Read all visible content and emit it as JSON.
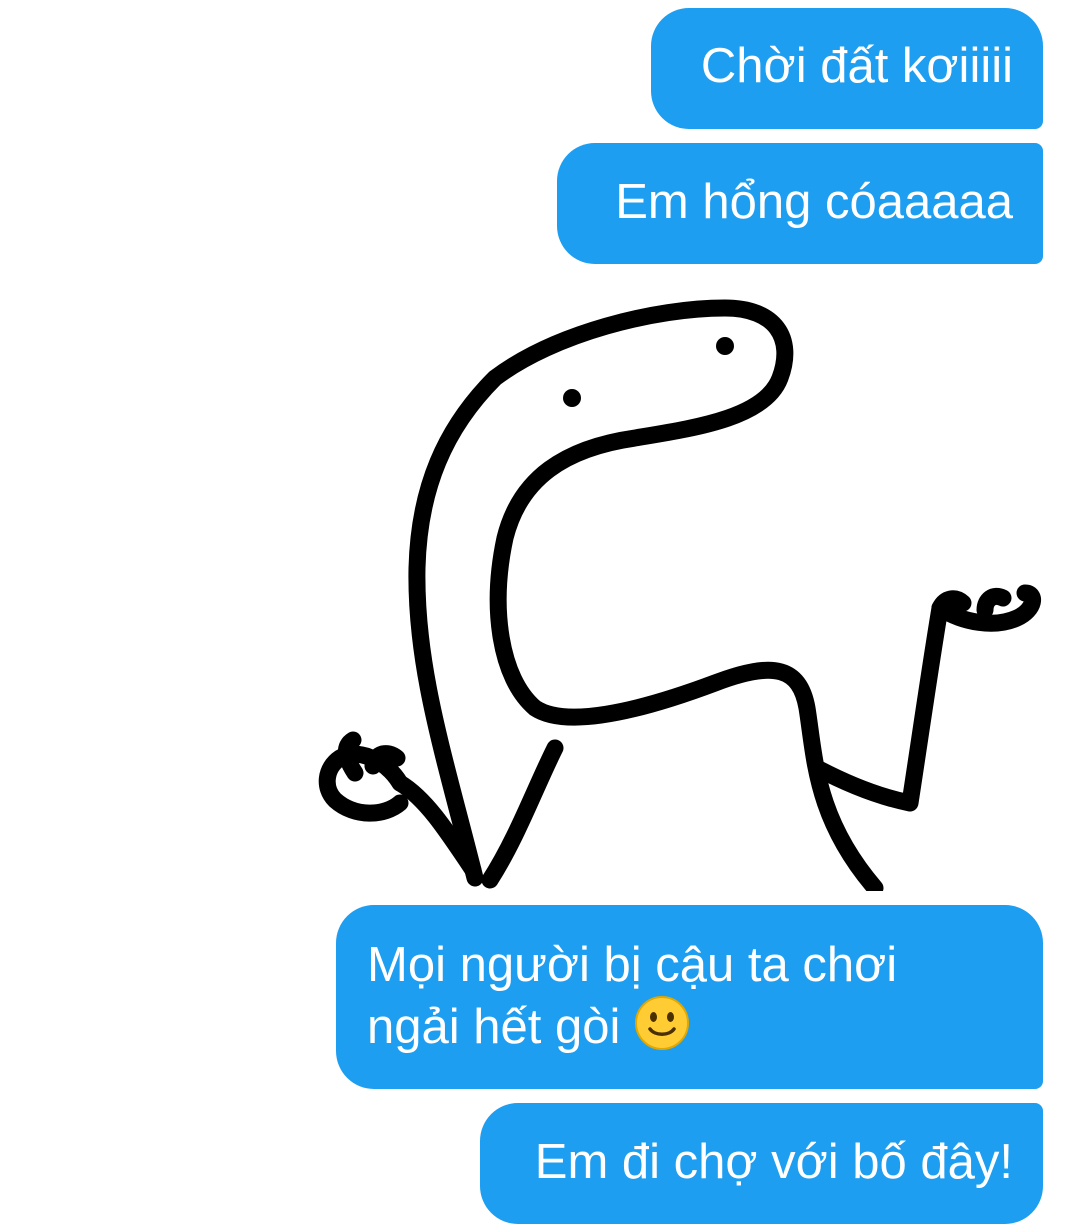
{
  "messages": [
    {
      "text": "Chời đất kơiiiii"
    },
    {
      "text": "Em hổng cóaaaaa"
    },
    {
      "sticker": "doodle-shrug-sticker"
    },
    {
      "line1": "Mọi người bị cậu ta chơi",
      "line2": "ngải hết gòi",
      "emoji": "slightly-smiling-face"
    },
    {
      "text": "Em đi chợ với bố đây!"
    }
  ],
  "colors": {
    "bubble": "#1e9ef0",
    "bubble_text": "#ffffff",
    "background": "#ffffff"
  }
}
